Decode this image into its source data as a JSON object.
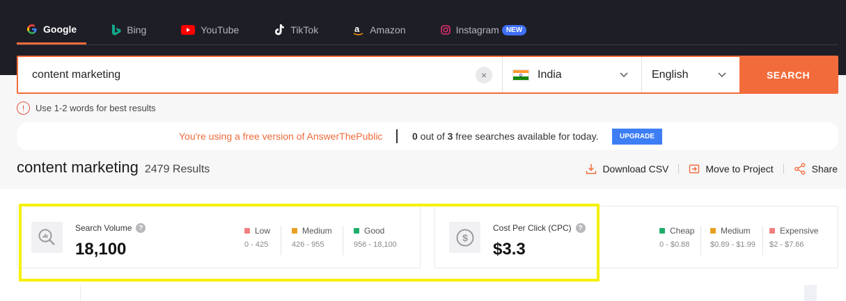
{
  "tabs": [
    {
      "label": "Google",
      "active": true
    },
    {
      "label": "Bing",
      "active": false
    },
    {
      "label": "YouTube",
      "active": false
    },
    {
      "label": "TikTok",
      "active": false
    },
    {
      "label": "Amazon",
      "active": false
    },
    {
      "label": "Instagram",
      "active": false,
      "badge": "NEW"
    }
  ],
  "search": {
    "query": "content marketing",
    "clear_icon": "×",
    "country": "India",
    "language": "English",
    "button_label": "SEARCH"
  },
  "hint": {
    "text": "Use 1-2 words for best results",
    "icon": "!"
  },
  "notice": {
    "free_text": "You're using a free version of AnswerThePublic",
    "count_text_pre": "0",
    "count_text_mid": " out of ",
    "count_text_num": "3",
    "count_text_post": " free searches available for today.",
    "upgrade_label": "UPGRADE"
  },
  "results": {
    "keyword": "content marketing",
    "count": "2479 Results"
  },
  "actions": {
    "download": "Download CSV",
    "move": "Move to Project",
    "share": "Share"
  },
  "volume_card": {
    "label": "Search Volume",
    "value": "18,100",
    "help": "?",
    "legend": [
      {
        "name": "Low",
        "range": "0 - 425",
        "color": "#f08080"
      },
      {
        "name": "Medium",
        "range": "426 - 955",
        "color": "#e6a020"
      },
      {
        "name": "Good",
        "range": "956 - 18,100",
        "color": "#1eae6a"
      }
    ]
  },
  "cpc_card": {
    "label": "Cost Per Click (CPC)",
    "value": "$3.3",
    "help": "?",
    "legend": [
      {
        "name": "Cheap",
        "range": "0 - $0.88",
        "color": "#1eae6a"
      },
      {
        "name": "Medium",
        "range": "$0.89 - $1.99",
        "color": "#e6a020"
      },
      {
        "name": "Expensive",
        "range": "$2 - $7.66",
        "color": "#f08080"
      }
    ]
  },
  "colors": {
    "accent": "#f26b3a",
    "topbar": "#1e1e26",
    "upgrade": "#3d7ef5",
    "highlight": "#f7f000"
  }
}
